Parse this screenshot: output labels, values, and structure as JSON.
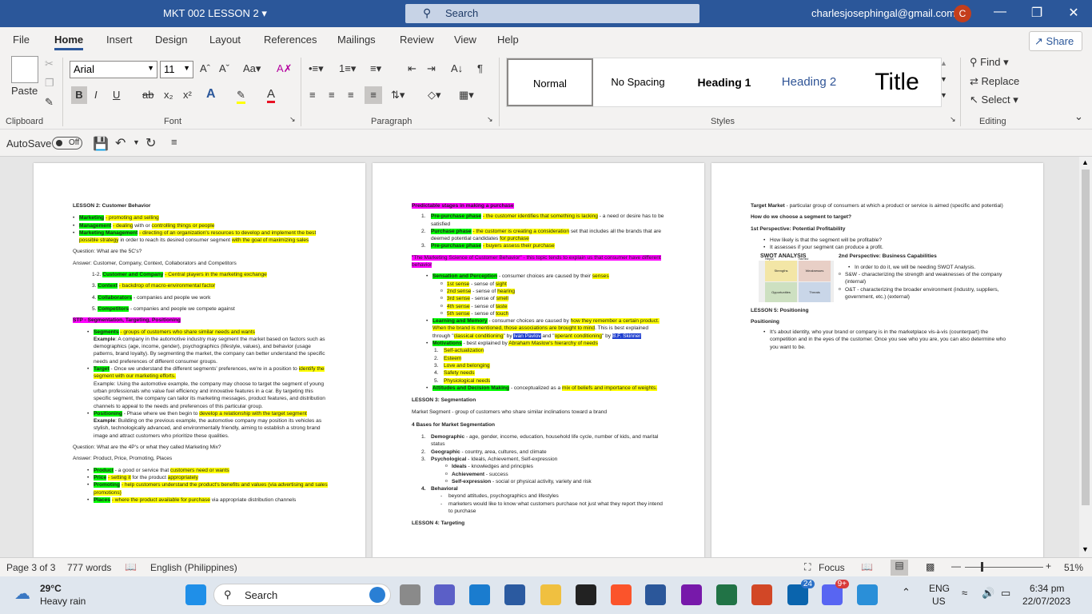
{
  "titlebar": {
    "doc_title": "MKT 002 LESSON 2",
    "search_placeholder": "Search",
    "account": "charlesjosephingal@gmail.com",
    "avatar_initial": "C",
    "minimize": "—",
    "restore": "❐",
    "close": "✕"
  },
  "tabs": [
    "File",
    "Home",
    "Insert",
    "Design",
    "Layout",
    "References",
    "Mailings",
    "Review",
    "View",
    "Help"
  ],
  "share_label": "Share",
  "ribbon": {
    "clipboard": {
      "label": "Clipboard",
      "paste": "Paste"
    },
    "font": {
      "label": "Font",
      "family": "Arial",
      "size": "11"
    },
    "paragraph": {
      "label": "Paragraph"
    },
    "styles": {
      "label": "Styles",
      "items": [
        "Normal",
        "No Spacing",
        "Heading 1",
        "Heading 2",
        "Title"
      ]
    },
    "editing": {
      "label": "Editing",
      "find": "Find",
      "replace": "Replace",
      "select": "Select"
    }
  },
  "qat": {
    "autosave_label": "AutoSave",
    "autosave_state": "Off"
  },
  "doc": {
    "p1": {
      "title": "LESSON 2: Customer Behavior",
      "q1": "Question: What are the 5C's?",
      "a1": "Answer: Customer, Company, Context, Collaborators and Competitors",
      "c1": "1-2. Customer and Company - Central players in the marketing exchange",
      "c3": "3. Context - backdrop of macro-environmental factor",
      "c4": "4. Collaborators - companies and people we work",
      "c5": "5. Competitors - companies and people we compete against",
      "stp": "STP - Segmentation, Targeting, Positioning",
      "q2": "Question: What are the 4P's or what they called Marketing Mix?",
      "a2": "Answer: Product, Price, Promoting, Places"
    },
    "p2": {
      "h1": "Predictable stages in making a purchase",
      "h2": "\"The Marketing Science of Customer Behavior\" - this topic tends to explain us that consumer have different behavior",
      "l3": "LESSON 3: Segmentation",
      "ms": "Market Segment - group of customers who share similar inclinations toward a brand",
      "bases": "4 Bases for Market Segmentation",
      "l4": "LESSON 4: Targeting"
    },
    "p3": {
      "tm": "Target Market - particular group of consumers at which a product or service is aimed (specific and potential)",
      "q": "How do we choose a segment to target?",
      "pp1": "1st Perspective: Potential Profitability",
      "b1": "How likely is that the segment will be profitable?",
      "b2": "It assesses if your segment can produce a profit.",
      "swot": "SWOT ANALYSIS",
      "pp2": "2nd Perspective: Business Capabilities",
      "swot_labels": [
        "Helpful",
        "Harmful",
        "Strengths",
        "Weaknesses",
        "Opportunities",
        "Threats"
      ],
      "c1": "In order to do it, we will be needing SWOT Analysis.",
      "c2": "S&W - characterizing the strength and weaknesses of the company (internal)",
      "c3": "O&T - characterizing the broader environment (industry, suppliers, government, etc.) (external)",
      "l5": "LESSON 5: Positioning",
      "pos": "Positioning",
      "posb": "It's about identity, who your brand or company is in the marketplace vis-à-vis (counterpart) the competition and in the eyes of the customer. Once you see who you are, you can also determine who you want to be."
    }
  },
  "status": {
    "page": "Page 3 of 3",
    "words": "777 words",
    "language": "English (Philippines)",
    "focus": "Focus",
    "zoom": "51%"
  },
  "taskbar": {
    "temp": "29°C",
    "weather": "Heavy rain",
    "search": "Search",
    "lang1": "ENG",
    "lang2": "US",
    "time": "6:34 pm",
    "date": "22/07/2023",
    "badge_mail": "24",
    "badge_discord": "9+"
  }
}
